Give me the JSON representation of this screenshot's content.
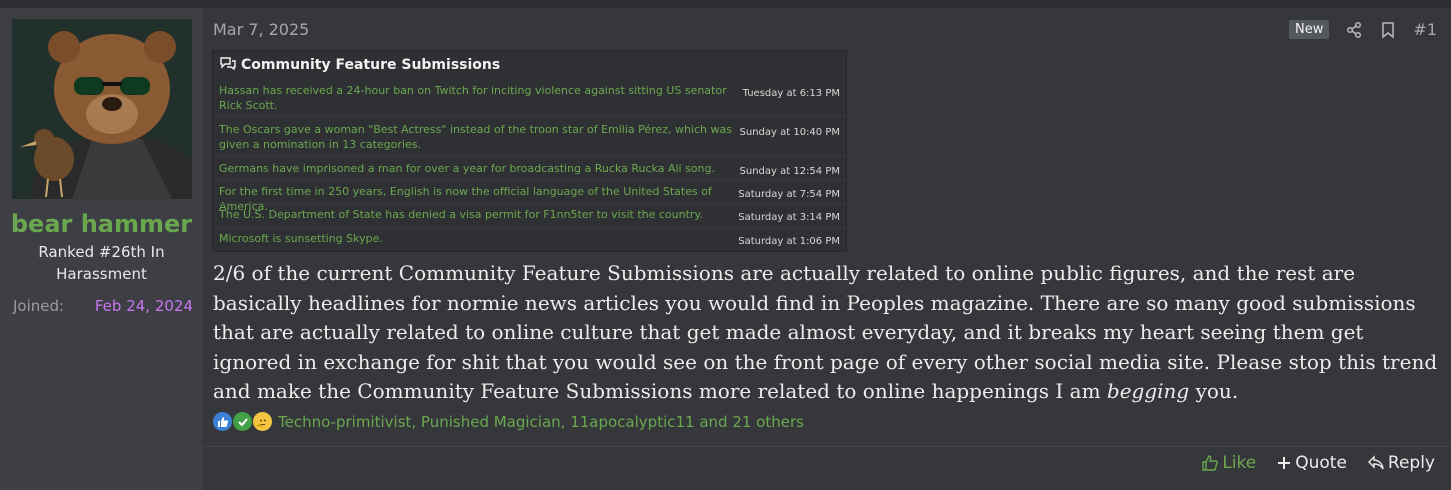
{
  "author": {
    "username": "bear hammer",
    "rank": "Ranked #26th In Harassment",
    "joined_label": "Joined:",
    "joined_value": "Feb 24, 2024"
  },
  "post": {
    "date": "Mar 7, 2025",
    "badge": "New",
    "number": "#1",
    "embed": {
      "title": "Community Feature Submissions",
      "items": [
        {
          "text": "Hassan has received a 24-hour ban on Twitch for inciting violence against sitting US senator Rick Scott.",
          "time": "Tuesday at 6:13 PM"
        },
        {
          "text": "The Oscars gave a woman \"Best Actress\" instead of the troon star of Emilia Pérez, which was given a nomination in 13 categories.",
          "time": "Sunday at 10:40 PM"
        },
        {
          "text": "Germans have imprisoned a man for over a year for broadcasting a Rucka Rucka Ali song.",
          "time": "Sunday at 12:54 PM"
        },
        {
          "text": "For the first time in 250 years, English is now the official language of the United States of America.",
          "time": "Saturday at 7:54 PM"
        },
        {
          "text": "The U.S. Department of State has denied a visa permit for F1nn5ter to visit the country.",
          "time": "Saturday at 3:14 PM"
        },
        {
          "text": "Microsoft is sunsetting Skype.",
          "time": "Saturday at 1:06 PM"
        }
      ]
    },
    "body_before": "2/6 of the current Community Feature Submissions are actually related to online public figures, and the rest are basically headlines for normie news articles you would find in Peoples magazine. There are so many good submissions that are actually related to online culture that get made almost everyday, and it breaks my heart seeing them get ignored in exchange for shit that you would see on the front page of every other social media site. Please stop this trend and make the Community Feature Submissions more related to online happenings I am ",
    "body_emphasis": "begging",
    "body_after": " you.",
    "reactions": {
      "icons": [
        "thumbs-up-icon",
        "check-icon",
        "thinking-face-icon"
      ],
      "names": "Techno-primitivist, Punished Magician, 11apocalyptic11 and 21 others"
    },
    "actions": {
      "like": "Like",
      "quote": "Quote",
      "reply": "Reply"
    }
  },
  "colors": {
    "accent_green": "#6aa84f",
    "joined_purple": "#c678f0",
    "background": "#35373b"
  }
}
